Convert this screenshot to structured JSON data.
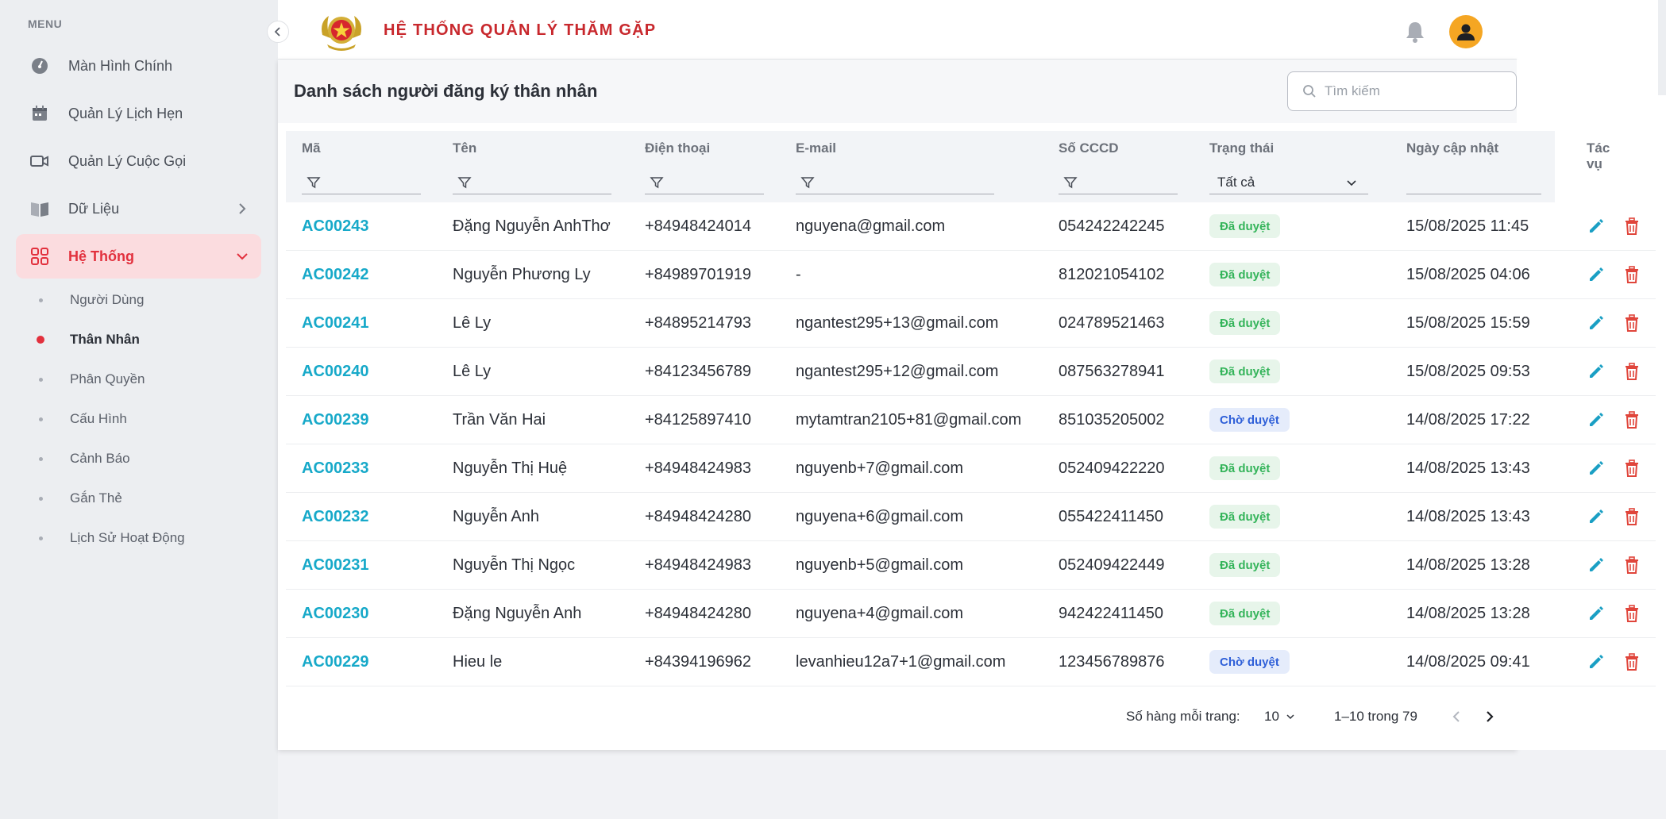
{
  "sidebar": {
    "menu_title": "MENU",
    "items": [
      {
        "label": "Màn Hình Chính",
        "icon": "dashboard-icon"
      },
      {
        "label": "Quản Lý Lịch Hẹn",
        "icon": "calendar-icon"
      },
      {
        "label": "Quản Lý Cuộc Gọi",
        "icon": "video-camera-icon"
      },
      {
        "label": "Dữ Liệu",
        "icon": "book-icon"
      },
      {
        "label": "Hệ Thống",
        "icon": "grid-icon"
      }
    ],
    "sub_items": [
      {
        "label": "Người Dùng"
      },
      {
        "label": "Thân Nhân"
      },
      {
        "label": "Phân Quyền"
      },
      {
        "label": "Cấu Hình"
      },
      {
        "label": "Cảnh Báo"
      },
      {
        "label": "Gắn Thẻ"
      },
      {
        "label": "Lịch Sử Hoạt Động"
      }
    ]
  },
  "header": {
    "app_title": "HỆ THỐNG QUẢN LÝ THĂM GẶP"
  },
  "page": {
    "title": "Danh sách người đăng ký thân nhân",
    "search_placeholder": "Tìm kiếm"
  },
  "table": {
    "columns": [
      "Mã",
      "Tên",
      "Điện thoại",
      "E-mail",
      "Số CCCD",
      "Trạng thái",
      "Ngày cập nhật",
      "Tác vụ"
    ],
    "status_filter": "Tất cả",
    "rows": [
      {
        "code": "AC00243",
        "name": "Đặng Nguyễn AnhThơ",
        "phone": "+84948424014",
        "email": "nguyena@gmail.com",
        "cccd": "054242242245",
        "status": "Đã duyệt",
        "updated": "15/08/2025 11:45"
      },
      {
        "code": "AC00242",
        "name": "Nguyễn Phương Ly",
        "phone": "+84989701919",
        "email": "-",
        "cccd": "812021054102",
        "status": "Đã duyệt",
        "updated": "15/08/2025 04:06"
      },
      {
        "code": "AC00241",
        "name": "Lê Ly",
        "phone": "+84895214793",
        "email": "ngantest295+13@gmail.com",
        "cccd": "024789521463",
        "status": "Đã duyệt",
        "updated": "15/08/2025 15:59"
      },
      {
        "code": "AC00240",
        "name": "Lê Ly",
        "phone": "+84123456789",
        "email": "ngantest295+12@gmail.com",
        "cccd": "087563278941",
        "status": "Đã duyệt",
        "updated": "15/08/2025 09:53"
      },
      {
        "code": "AC00239",
        "name": "Trần Văn Hai",
        "phone": "+84125897410",
        "email": "mytamtran2105+81@gmail.com",
        "cccd": "851035205002",
        "status": "Chờ duyệt",
        "updated": "14/08/2025 17:22"
      },
      {
        "code": "AC00233",
        "name": "Nguyễn Thị Huệ",
        "phone": "+84948424983",
        "email": "nguyenb+7@gmail.com",
        "cccd": "052409422220",
        "status": "Đã duyệt",
        "updated": "14/08/2025 13:43"
      },
      {
        "code": "AC00232",
        "name": "Nguyễn Anh",
        "phone": "+84948424280",
        "email": "nguyena+6@gmail.com",
        "cccd": "055422411450",
        "status": "Đã duyệt",
        "updated": "14/08/2025 13:43"
      },
      {
        "code": "AC00231",
        "name": "Nguyễn Thị Ngọc",
        "phone": "+84948424983",
        "email": "nguyenb+5@gmail.com",
        "cccd": "052409422449",
        "status": "Đã duyệt",
        "updated": "14/08/2025 13:28"
      },
      {
        "code": "AC00230",
        "name": "Đặng Nguyễn Anh",
        "phone": "+84948424280",
        "email": "nguyena+4@gmail.com",
        "cccd": "942422411450",
        "status": "Đã duyệt",
        "updated": "14/08/2025 13:28"
      },
      {
        "code": "AC00229",
        "name": "Hieu le",
        "phone": "+84394196962",
        "email": "levanhieu12a7+1@gmail.com",
        "cccd": "123456789876",
        "status": "Chờ duyệt",
        "updated": "14/08/2025 09:41"
      }
    ]
  },
  "pagination": {
    "rows_per_page_label": "Số hàng mỗi trang:",
    "rows_per_page": "10",
    "range": "1–10 trong 79"
  },
  "colors": {
    "accent": "#e2303d",
    "link": "#17a9c9",
    "approved": "#34b45a",
    "pending": "#2e5fd8",
    "edit": "#1a9fc4",
    "delete": "#e0453b",
    "avatar": "#f5a623"
  }
}
